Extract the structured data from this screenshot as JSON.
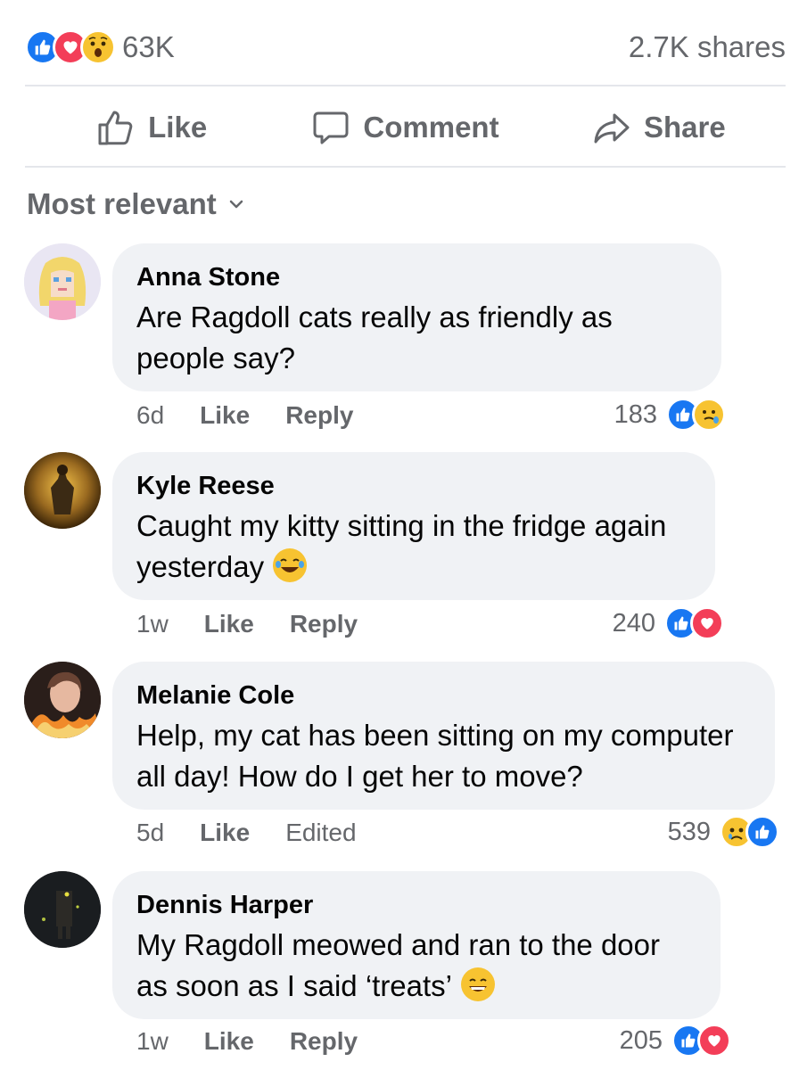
{
  "post_summary": {
    "reaction_icons": [
      "like-icon",
      "love-icon",
      "wow-icon"
    ],
    "reaction_count": "63K",
    "shares": "2.7K shares"
  },
  "actions": {
    "like_label": "Like",
    "comment_label": "Comment",
    "share_label": "Share"
  },
  "sort": {
    "label": "Most relevant",
    "icon": "chevron-down-icon"
  },
  "comments": [
    {
      "author": "Anna Stone",
      "text": "Are Ragdoll cats really as friendly as people say?",
      "time": "6d",
      "like_label": "Like",
      "second_label": "Reply",
      "reaction_count": "183",
      "reaction_icons": [
        "like-icon",
        "care-icon"
      ]
    },
    {
      "author": "Kyle Reese",
      "text": "Caught my kitty sitting in the fridge again yesterday",
      "text_emoji": "laughing-emoji",
      "time": "1w",
      "like_label": "Like",
      "second_label": "Reply",
      "reaction_count": "240",
      "reaction_icons": [
        "like-icon",
        "love-icon"
      ]
    },
    {
      "author": "Melanie Cole",
      "text": "Help, my cat has been sitting on my computer all day! How do I get her to move?",
      "time": "5d",
      "like_label": "Like",
      "second_label": "Edited",
      "reaction_count": "539",
      "reaction_icons": [
        "sad-icon",
        "like-icon"
      ]
    },
    {
      "author": "Dennis Harper",
      "text": "My Ragdoll meowed and ran to the door as soon as I said ‘treats’",
      "text_emoji": "grinning-emoji",
      "time": "1w",
      "like_label": "Like",
      "second_label": "Reply",
      "reaction_count": "205",
      "reaction_icons": [
        "like-icon",
        "love-icon"
      ]
    }
  ],
  "colors": {
    "like": "#1877f2",
    "love": "#f33e58",
    "emoji": "#f7c331",
    "secondary_text": "#65676b",
    "bubble": "#f0f2f5",
    "divider": "#e4e6eb"
  }
}
